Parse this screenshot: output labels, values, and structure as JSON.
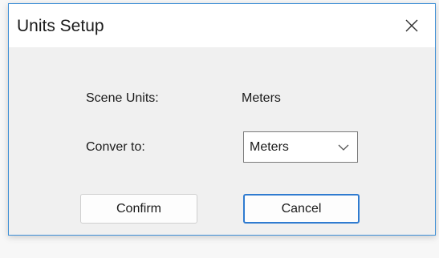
{
  "window": {
    "title": "Units Setup",
    "close_icon": "close-icon"
  },
  "scene_units": {
    "label": "Scene Units:",
    "value": "Meters"
  },
  "convert_to": {
    "label": "Conver to:",
    "selected": "Meters",
    "dropdown_icon": "chevron-down-icon"
  },
  "buttons": {
    "confirm": "Confirm",
    "cancel": "Cancel"
  },
  "colors": {
    "accent": "#2f7bd0",
    "dialog_bg": "#f0f0f0",
    "titlebar_bg": "#ffffff"
  }
}
